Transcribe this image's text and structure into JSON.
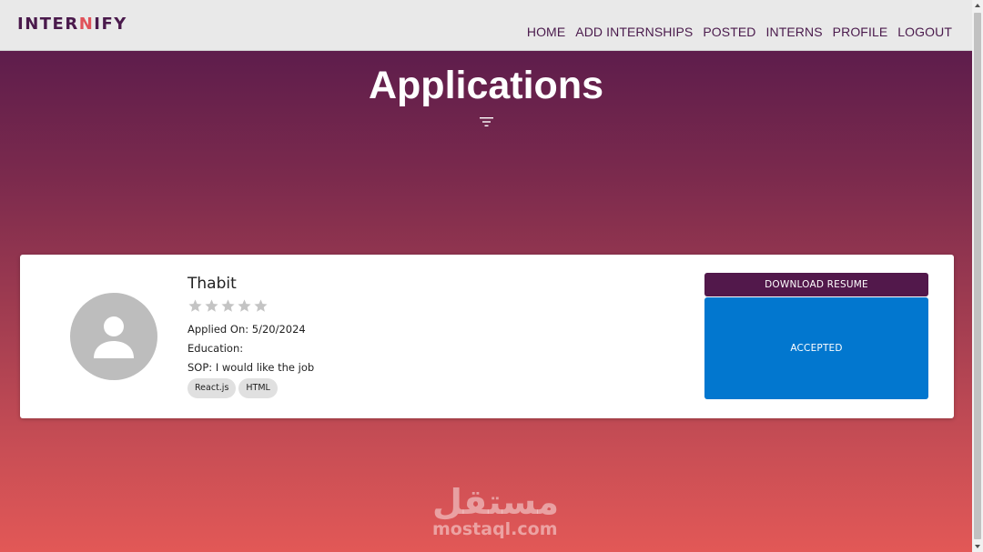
{
  "navbar": {
    "logo_text": "INTERNIFY",
    "links": [
      "HOME",
      "ADD INTERNSHIPS",
      "POSTED",
      "INTERNS",
      "PROFILE",
      "LOGOUT"
    ]
  },
  "page": {
    "title": "Applications",
    "filter_icon": "filter-list-icon"
  },
  "application": {
    "name": "Thabit",
    "rating": {
      "value": 0,
      "max": 5
    },
    "applied_on": "Applied On: 5/20/2024",
    "education": "Education:",
    "sop": "SOP: I would like the job",
    "skills": [
      "React.js",
      "HTML"
    ],
    "download_label": "DOWNLOAD RESUME",
    "status_label": "ACCEPTED",
    "avatar_icon": "person-icon"
  },
  "watermark": {
    "arabic": "مستقل",
    "latin": "mostaql.com"
  },
  "colors": {
    "nav_text": "#4a1a4c",
    "gradient_top": "#5e1d4c",
    "gradient_bottom": "#e25856",
    "download_button": "#52184b",
    "status_button": "#0277cf"
  }
}
